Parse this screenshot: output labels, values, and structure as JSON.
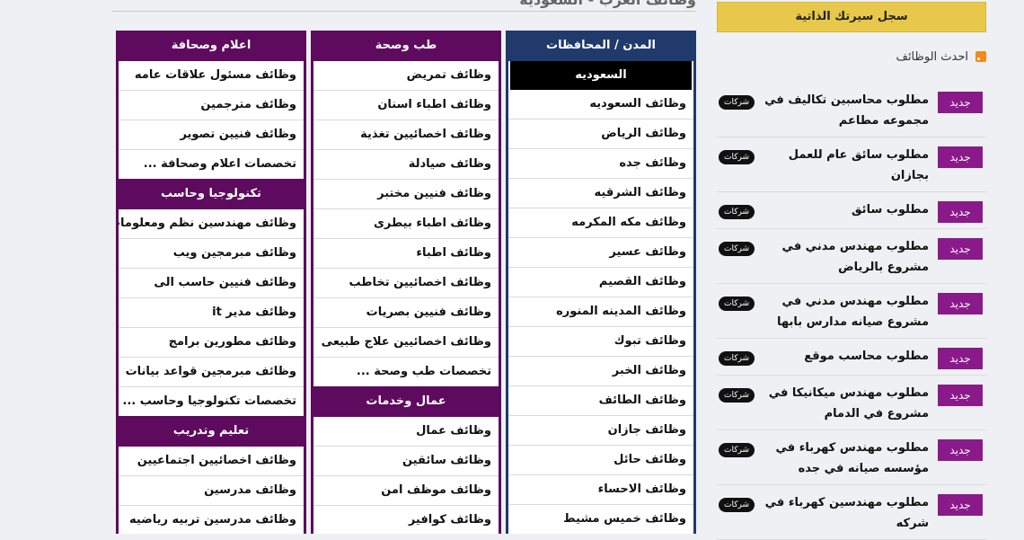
{
  "page_title": "وظائف العرب - السعودية",
  "sidebar": {
    "cv_button": "سجل سيرتك الذاتية",
    "latest_jobs_title": "احدث الوظائف",
    "new_label": "جديد",
    "jobs": [
      {
        "title": "مطلوب محاسبين تكاليف في مجموعه مطاعم",
        "category": "شركات"
      },
      {
        "title": "مطلوب سائق عام للعمل بجازان",
        "category": "شركات"
      },
      {
        "title": "مطلوب سائق",
        "category": "شركات"
      },
      {
        "title": "مطلوب مهندس مدني في مشروع بالرياض",
        "category": "شركات"
      },
      {
        "title": "مطلوب مهندس مدني في مشروع صيانه مدارس بابها",
        "category": "شركات"
      },
      {
        "title": "مطلوب محاسب موقع",
        "category": "شركات"
      },
      {
        "title": "مطلوب مهندس ميكانيكا في مشروع في الدمام",
        "category": "شركات"
      },
      {
        "title": "مطلوب مهندس كهرباء في مؤسسه صيانه في جده",
        "category": "شركات"
      },
      {
        "title": "مطلوب مهندسين كهرباء في شركه",
        "category": "شركات"
      }
    ]
  },
  "city_column": {
    "header": "المدن / المحافظات",
    "subheader": "السعوديه",
    "links": [
      "وظائف السعوديه",
      "وظائف الرياض",
      "وظائف جده",
      "وظائف الشرقيه",
      "وظائف مكه المكرمه",
      "وظائف عسير",
      "وظائف القصيم",
      "وظائف المدينه المنوره",
      "وظائف تبوك",
      "وظائف الخبر",
      "وظائف الطائف",
      "وظائف جازان",
      "وظائف حائل",
      "وظائف الاحساء",
      "وظائف خميس مشيط"
    ]
  },
  "health_column": {
    "header": "طب وصحة",
    "links": [
      "وظائف تمريض",
      "وظائف اطباء اسنان",
      "وظائف اخصائيين تغذية",
      "وظائف صيادلة",
      "وظائف فنيين مختبر",
      "وظائف اطباء بيطرى",
      "وظائف اطباء",
      "وظائف اخصائيين تخاطب",
      "وظائف فنيين بصريات",
      "وظائف اخصائيين علاج طبيعى",
      "تخصصات طب وصحة ..."
    ],
    "header2": "عمال وخدمات",
    "links2": [
      "وظائف عمال",
      "وظائف سائقين",
      "وظائف موظف امن",
      "وظائف كوافير"
    ]
  },
  "media_column": {
    "header": "اعلام وصحافة",
    "links": [
      "وظائف مسئول علاقات عامه",
      "وظائف مترجمين",
      "وظائف فنيين تصوير",
      "تخصصات اعلام وصحافة ..."
    ],
    "header2": "تكنولوجيا وحاسب",
    "links2": [
      "وظائف مهندسين نظم ومعلومات",
      "وظائف مبرمجين ويب",
      "وظائف فنيين حاسب الى",
      "وظائف مدير it",
      "وظائف مطورين برامج",
      "وظائف مبرمجين قواعد بيانات",
      "تخصصات تكنولوجيا وحاسب ..."
    ],
    "header3": "تعليم وتدريب",
    "links3": [
      "وظائف اخصائيين اجتماعيين",
      "وظائف مدرسين",
      "وظائف مدرسين تربيه رياضيه"
    ]
  }
}
